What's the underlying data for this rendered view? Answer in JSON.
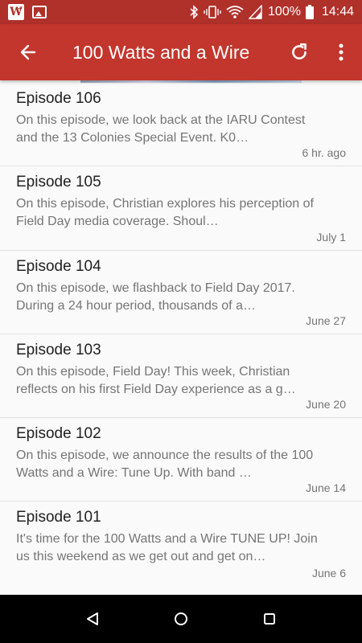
{
  "status_bar": {
    "battery_percent": "100%",
    "time": "14:44"
  },
  "toolbar": {
    "title": "100 Watts and a Wire"
  },
  "episodes": [
    {
      "title": "Episode 106",
      "description": "On this episode, we look back at the IARU Contest and the 13 Colonies Special Event. K0…",
      "date": "6 hr. ago"
    },
    {
      "title": "Episode 105",
      "description": "On this episode, Christian explores his perception of Field Day media coverage. Shoul…",
      "date": "July 1"
    },
    {
      "title": "Episode 104",
      "description": "On this episode, we flashback to Field Day 2017. During a 24 hour period, thousands of a…",
      "date": "June 27"
    },
    {
      "title": "Episode 103",
      "description": "On this episode, Field Day! This week, Christian reflects on his first Field Day experience as a g…",
      "date": "June 20"
    },
    {
      "title": "Episode 102",
      "description": "On this episode, we announce the results of the 100 Watts and a Wire: Tune Up. With band …",
      "date": "June 14"
    },
    {
      "title": "Episode 101",
      "description": "It's time for the 100 Watts and a Wire TUNE UP! Join us this weekend as we get out and get on…",
      "date": "June 6"
    }
  ],
  "colors": {
    "status_bar": "#b0302a",
    "toolbar": "#c2362d",
    "background": "#fafafa"
  }
}
